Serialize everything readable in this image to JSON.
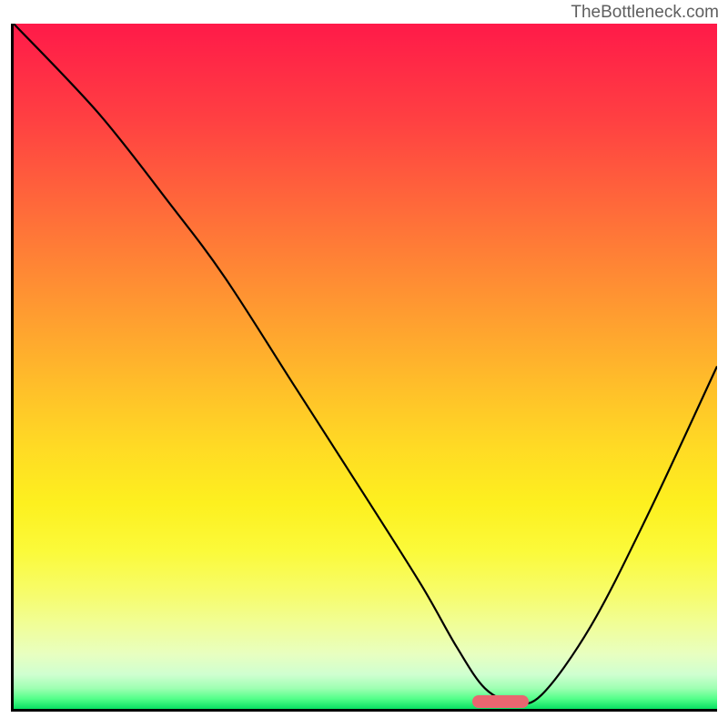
{
  "watermark": "TheBottleneck.com",
  "chart_data": {
    "type": "line",
    "title": "",
    "xlabel": "",
    "ylabel": "",
    "xlim": [
      0,
      100
    ],
    "ylim": [
      0,
      100
    ],
    "series": [
      {
        "name": "curve",
        "x": [
          0,
          12,
          22,
          30,
          40,
          50,
          58,
          63,
          67,
          71,
          75,
          82,
          90,
          100
        ],
        "values": [
          100,
          87,
          74,
          63,
          47,
          31,
          18,
          9,
          3,
          1,
          2,
          12,
          28,
          50
        ]
      }
    ],
    "marker": {
      "x_start": 65,
      "x_end": 73,
      "y": 1.5
    },
    "gradient": {
      "type": "vertical",
      "stops": [
        "#ff1a49",
        "#ffdb24",
        "#08e062"
      ]
    }
  }
}
